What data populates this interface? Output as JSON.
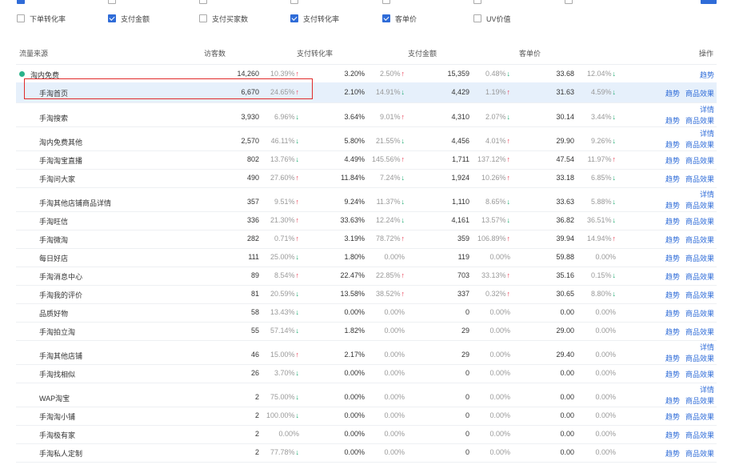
{
  "metric_options": [
    {
      "label": "下单转化率",
      "checked": false
    },
    {
      "label": "支付金额",
      "checked": true
    },
    {
      "label": "支付买家数",
      "checked": false
    },
    {
      "label": "支付转化率",
      "checked": true
    },
    {
      "label": "客单价",
      "checked": true
    },
    {
      "label": "UV价值",
      "checked": false
    }
  ],
  "headers": {
    "source": "流量来源",
    "visitors": "访客数",
    "conv": "支付转化率",
    "amount": "支付金额",
    "avg": "客单价",
    "ops": "操作"
  },
  "actions": {
    "detail": "详情",
    "trend": "趋势",
    "goods": "商品效果"
  },
  "rows": [
    {
      "name": "淘内免费",
      "v": "14,260",
      "vp": "10.39%",
      "vd": "up",
      "c": "3.20%",
      "cp": "2.50%",
      "cd": "up",
      "a": "15,359",
      "ap": "0.48%",
      "ad": "dn",
      "u": "33.68",
      "up_": "12.04%",
      "ud": "dn",
      "ops": [
        "trend"
      ]
    },
    {
      "name": "手淘首页",
      "v": "6,670",
      "vp": "24.65%",
      "vd": "up",
      "c": "2.10%",
      "cp": "14.91%",
      "cd": "dn",
      "a": "4,429",
      "ap": "1.19%",
      "ad": "up",
      "u": "31.63",
      "up_": "4.59%",
      "ud": "dn",
      "ops": [
        "trend",
        "goods"
      ]
    },
    {
      "name": "手淘搜索",
      "v": "3,930",
      "vp": "6.96%",
      "vd": "dn",
      "c": "3.64%",
      "cp": "9.01%",
      "cd": "up",
      "a": "4,310",
      "ap": "2.07%",
      "ad": "dn",
      "u": "30.14",
      "up_": "3.44%",
      "ud": "dn",
      "ops": [
        "detail",
        "trend",
        "goods"
      ]
    },
    {
      "name": "淘内免费其他",
      "v": "2,570",
      "vp": "46.11%",
      "vd": "dn",
      "c": "5.80%",
      "cp": "21.55%",
      "cd": "dn",
      "a": "4,456",
      "ap": "4.01%",
      "ad": "up",
      "u": "29.90",
      "up_": "9.26%",
      "ud": "dn",
      "ops": [
        "detail",
        "trend",
        "goods"
      ]
    },
    {
      "name": "手淘淘宝直播",
      "v": "802",
      "vp": "13.76%",
      "vd": "dn",
      "c": "4.49%",
      "cp": "145.56%",
      "cd": "up",
      "a": "1,711",
      "ap": "137.12%",
      "ad": "up",
      "u": "47.54",
      "up_": "11.97%",
      "ud": "up",
      "ops": [
        "trend",
        "goods"
      ]
    },
    {
      "name": "手淘问大家",
      "v": "490",
      "vp": "27.60%",
      "vd": "up",
      "c": "11.84%",
      "cp": "7.24%",
      "cd": "dn",
      "a": "1,924",
      "ap": "10.26%",
      "ad": "up",
      "u": "33.18",
      "up_": "6.85%",
      "ud": "dn",
      "ops": [
        "trend",
        "goods"
      ]
    },
    {
      "name": "手淘其他店铺商品详情",
      "v": "357",
      "vp": "9.51%",
      "vd": "up",
      "c": "9.24%",
      "cp": "11.37%",
      "cd": "dn",
      "a": "1,110",
      "ap": "8.65%",
      "ad": "dn",
      "u": "33.63",
      "up_": "5.88%",
      "ud": "dn",
      "ops": [
        "detail",
        "trend",
        "goods"
      ]
    },
    {
      "name": "手淘旺信",
      "v": "336",
      "vp": "21.30%",
      "vd": "up",
      "c": "33.63%",
      "cp": "12.24%",
      "cd": "dn",
      "a": "4,161",
      "ap": "13.57%",
      "ad": "dn",
      "u": "36.82",
      "up_": "36.51%",
      "ud": "dn",
      "ops": [
        "trend",
        "goods"
      ]
    },
    {
      "name": "手淘微淘",
      "v": "282",
      "vp": "0.71%",
      "vd": "up",
      "c": "3.19%",
      "cp": "78.72%",
      "cd": "up",
      "a": "359",
      "ap": "106.89%",
      "ad": "up",
      "u": "39.94",
      "up_": "14.94%",
      "ud": "up",
      "ops": [
        "trend",
        "goods"
      ]
    },
    {
      "name": "每日好店",
      "v": "111",
      "vp": "25.00%",
      "vd": "dn",
      "c": "1.80%",
      "cp": "0.00%",
      "cd": "",
      "a": "119",
      "ap": "0.00%",
      "ad": "",
      "u": "59.88",
      "up_": "0.00%",
      "ud": "",
      "ops": [
        "trend",
        "goods"
      ]
    },
    {
      "name": "手淘消息中心",
      "v": "89",
      "vp": "8.54%",
      "vd": "up",
      "c": "22.47%",
      "cp": "22.85%",
      "cd": "up",
      "a": "703",
      "ap": "33.13%",
      "ad": "up",
      "u": "35.16",
      "up_": "0.15%",
      "ud": "dn",
      "ops": [
        "trend",
        "goods"
      ]
    },
    {
      "name": "手淘我的评价",
      "v": "81",
      "vp": "20.59%",
      "vd": "dn",
      "c": "13.58%",
      "cp": "38.52%",
      "cd": "up",
      "a": "337",
      "ap": "0.32%",
      "ad": "up",
      "u": "30.65",
      "up_": "8.80%",
      "ud": "dn",
      "ops": [
        "trend",
        "goods"
      ]
    },
    {
      "name": "品质好物",
      "v": "58",
      "vp": "13.43%",
      "vd": "dn",
      "c": "0.00%",
      "cp": "0.00%",
      "cd": "",
      "a": "0",
      "ap": "0.00%",
      "ad": "",
      "u": "0.00",
      "up_": "0.00%",
      "ud": "",
      "ops": [
        "trend",
        "goods"
      ]
    },
    {
      "name": "手淘拍立淘",
      "v": "55",
      "vp": "57.14%",
      "vd": "dn",
      "c": "1.82%",
      "cp": "0.00%",
      "cd": "",
      "a": "29",
      "ap": "0.00%",
      "ad": "",
      "u": "29.00",
      "up_": "0.00%",
      "ud": "",
      "ops": [
        "trend",
        "goods"
      ]
    },
    {
      "name": "手淘其他店铺",
      "v": "46",
      "vp": "15.00%",
      "vd": "up",
      "c": "2.17%",
      "cp": "0.00%",
      "cd": "",
      "a": "29",
      "ap": "0.00%",
      "ad": "",
      "u": "29.40",
      "up_": "0.00%",
      "ud": "",
      "ops": [
        "detail",
        "trend",
        "goods"
      ]
    },
    {
      "name": "手淘找相似",
      "v": "26",
      "vp": "3.70%",
      "vd": "dn",
      "c": "0.00%",
      "cp": "0.00%",
      "cd": "",
      "a": "0",
      "ap": "0.00%",
      "ad": "",
      "u": "0.00",
      "up_": "0.00%",
      "ud": "",
      "ops": [
        "trend",
        "goods"
      ]
    },
    {
      "name": "WAP淘宝",
      "v": "2",
      "vp": "75.00%",
      "vd": "dn",
      "c": "0.00%",
      "cp": "0.00%",
      "cd": "",
      "a": "0",
      "ap": "0.00%",
      "ad": "",
      "u": "0.00",
      "up_": "0.00%",
      "ud": "",
      "ops": [
        "detail",
        "trend",
        "goods"
      ]
    },
    {
      "name": "手淘淘小铺",
      "v": "2",
      "vp": "100.00%",
      "vd": "dn",
      "c": "0.00%",
      "cp": "0.00%",
      "cd": "",
      "a": "0",
      "ap": "0.00%",
      "ad": "",
      "u": "0.00",
      "up_": "0.00%",
      "ud": "",
      "ops": [
        "trend",
        "goods"
      ]
    },
    {
      "name": "手淘极有家",
      "v": "2",
      "vp": "0.00%",
      "vd": "",
      "c": "0.00%",
      "cp": "0.00%",
      "cd": "",
      "a": "0",
      "ap": "0.00%",
      "ad": "",
      "u": "0.00",
      "up_": "0.00%",
      "ud": "",
      "ops": [
        "trend",
        "goods"
      ]
    },
    {
      "name": "手淘私人定制",
      "v": "2",
      "vp": "77.78%",
      "vd": "dn",
      "c": "0.00%",
      "cp": "0.00%",
      "cd": "",
      "a": "0",
      "ap": "0.00%",
      "ad": "",
      "u": "0.00",
      "up_": "0.00%",
      "ud": "",
      "ops": [
        "trend",
        "goods"
      ]
    }
  ]
}
